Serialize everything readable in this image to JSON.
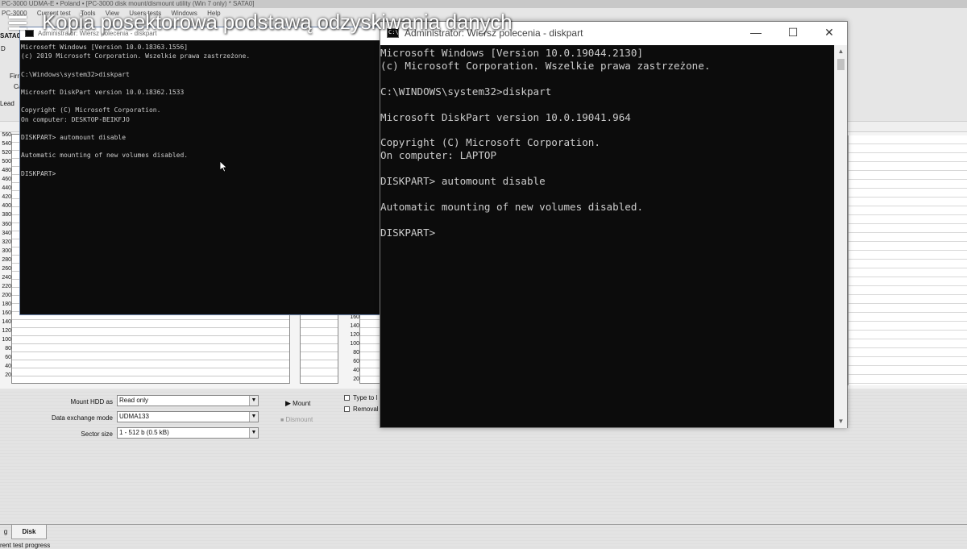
{
  "video": {
    "title": "Kopia posektorowa podstawą odzyskiwania danych",
    "menu_icon": "hamburger-menu-icon"
  },
  "background_app": {
    "title": "PC-3000 UDMA-E • Poland • [PC-3000 disk mount/dismount utility (Win 7 only) * SATA0]",
    "menu": [
      "PC-3000",
      "Current test",
      "Tools",
      "View",
      "Users tests",
      "Windows",
      "Help"
    ],
    "left_labels": {
      "sata": "SATA0",
      "d": "D",
      "firm": "Firm",
      "ca": "Ca",
      "lead": "Lead"
    },
    "left_axis": [
      "560",
      "540",
      "520",
      "500",
      "480",
      "460",
      "440",
      "420",
      "400",
      "380",
      "360",
      "340",
      "320",
      "300",
      "280",
      "260",
      "240",
      "220",
      "200",
      "180",
      "160",
      "140",
      "120",
      "100",
      "80",
      "60",
      "40",
      "20"
    ],
    "mid_axis": [
      "160",
      "140",
      "120",
      "100",
      "80",
      "60",
      "40",
      "20"
    ],
    "form": {
      "mount_label": "Mount HDD as",
      "mount_value": "Read only",
      "exchange_label": "Data exchange mode",
      "exchange_value": "UDMA133",
      "sector_label": "Sector size",
      "sector_value": "1 - 512 b (0.5 kB)"
    },
    "buttons": {
      "mount": "Mount",
      "dismount": "Dismount"
    },
    "checks": {
      "type_to": "Type to l",
      "removable": "Removal"
    },
    "tabs": {
      "first": "g",
      "disk": "Disk"
    },
    "status": "rent test progress"
  },
  "cmd_back": {
    "title": "Administrator: Wiersz polecenia - diskpart",
    "lines": [
      "Microsoft Windows [Version 10.0.18363.1556]",
      "(c) 2019 Microsoft Corporation. Wszelkie prawa zastrzeżone.",
      "",
      "C:\\Windows\\system32>diskpart",
      "",
      "Microsoft DiskPart version 10.0.18362.1533",
      "",
      "Copyright (C) Microsoft Corporation.",
      "On computer: DESKTOP-BEIKFJO",
      "",
      "DISKPART> automount disable",
      "",
      "Automatic mounting of new volumes disabled.",
      "",
      "DISKPART> "
    ]
  },
  "cmd_front": {
    "title": "Administrator: Wiersz polecenia - diskpart",
    "icon_text": "C:\\",
    "controls": {
      "minimize": "—",
      "maximize": "☐",
      "close": "✕"
    },
    "lines": [
      "Microsoft Windows [Version 10.0.19044.2130]",
      "(c) Microsoft Corporation. Wszelkie prawa zastrzeżone.",
      "",
      "C:\\WINDOWS\\system32>diskpart",
      "",
      "Microsoft DiskPart version 10.0.19041.964",
      "",
      "Copyright (C) Microsoft Corporation.",
      "On computer: LAPTOP",
      "",
      "DISKPART> automount disable",
      "",
      "Automatic mounting of new volumes disabled.",
      "",
      "DISKPART> "
    ],
    "scroll_up": "▲",
    "scroll_down": "▼"
  }
}
